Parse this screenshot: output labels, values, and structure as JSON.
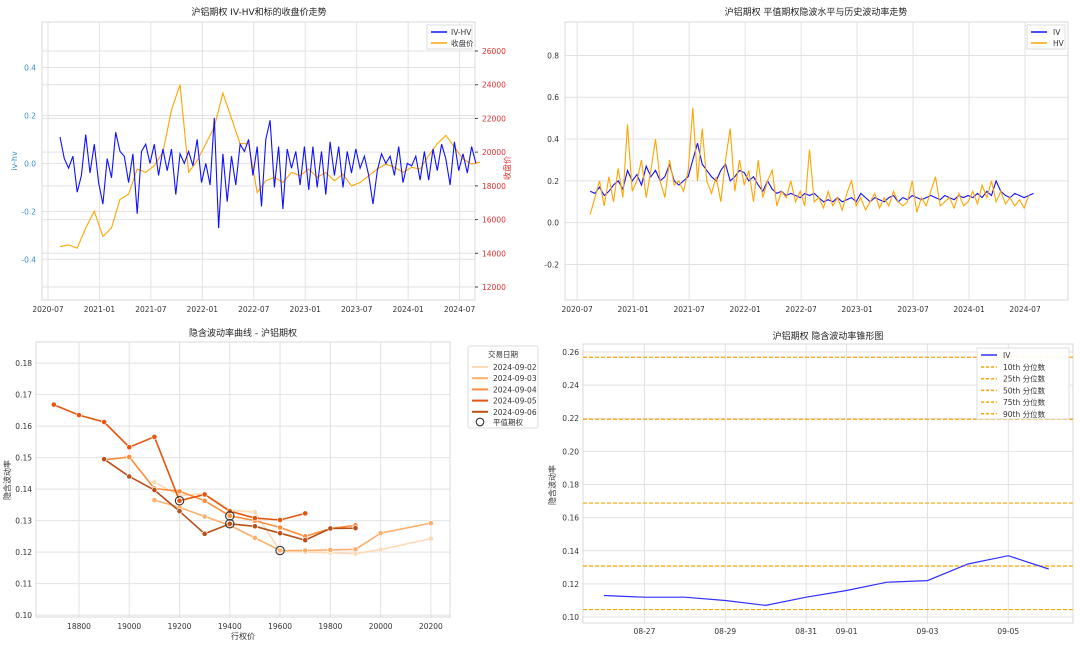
{
  "chart_data": [
    {
      "type": "line",
      "title": "沪铝期权 IV-HV和标的收盘价走势",
      "ylabel": "iv-hv",
      "ylabel_right": "收盘价",
      "ylim": [
        -0.57,
        0.59
      ],
      "ylim_right": [
        11230,
        27720
      ],
      "yticks": [
        -0.4,
        -0.2,
        0.0,
        0.2,
        0.4
      ],
      "yticks_right": [
        12000,
        14000,
        16000,
        18000,
        20000,
        22000,
        24000,
        26000
      ],
      "xticks": [
        "2020-07",
        "2021-01",
        "2021-07",
        "2022-01",
        "2022-07",
        "2023-01",
        "2023-07",
        "2024-01",
        "2024-07"
      ],
      "x_start": "2020-08",
      "legend": [
        "IV-HV",
        "收盘价"
      ],
      "legend_position": "top-right",
      "colors": {
        "ivhv": "#1010ff",
        "close": "#ffa500",
        "left_axis": "#3a8fc8",
        "right_axis": "#e03030"
      },
      "series": [
        {
          "name": "IV-HV",
          "step_months": 0.5,
          "values": [
            0.11,
            0.02,
            -0.02,
            0.03,
            -0.12,
            -0.05,
            0.12,
            -0.04,
            0.08,
            -0.08,
            -0.17,
            0.02,
            -0.06,
            0.13,
            0.05,
            0.03,
            -0.08,
            0.04,
            -0.21,
            0.05,
            0.08,
            0.0,
            0.08,
            -0.05,
            0.06,
            -0.03,
            0.06,
            -0.13,
            0.04,
            0.0,
            0.05,
            -0.01,
            0.1,
            -0.08,
            0.0,
            -0.09,
            0.19,
            -0.27,
            0.04,
            -0.16,
            0.03,
            -0.09,
            0.08,
            0.05,
            0.1,
            -0.05,
            0.07,
            -0.18,
            0.1,
            0.18,
            -0.1,
            0.07,
            -0.19,
            0.06,
            -0.02,
            0.05,
            -0.09,
            0.07,
            -0.11,
            0.07,
            -0.1,
            0.05,
            -0.13,
            0.09,
            -0.05,
            0.07,
            -0.1,
            0.05,
            -0.04,
            0.06,
            -0.02,
            0.03,
            -0.05,
            -0.17,
            -0.03,
            0.04,
            0.0,
            0.03,
            -0.05,
            0.07,
            -0.08,
            0.0,
            -0.01,
            0.03,
            -0.07,
            0.05,
            -0.07,
            0.06,
            -0.03,
            0.08,
            0.02,
            -0.09,
            0.09,
            -0.03,
            0.04,
            -0.04,
            0.07,
            0.0
          ]
        },
        {
          "name": "收盘价",
          "step_months": 1,
          "values": [
            14400,
            14500,
            14300,
            15500,
            16500,
            15000,
            15500,
            17200,
            17500,
            19000,
            18800,
            19200,
            20000,
            22500,
            24000,
            18800,
            19500,
            20500,
            21500,
            23500,
            22000,
            20500,
            20500,
            17600,
            18300,
            18500,
            18200,
            18800,
            18600,
            19000,
            18500,
            18800,
            18300,
            18700,
            18000,
            18200,
            18600,
            19000,
            19300,
            19100,
            18800,
            19100,
            19000,
            19800,
            20500,
            21000,
            20300,
            19600,
            19300,
            19400
          ]
        }
      ]
    },
    {
      "type": "line",
      "title": "沪铝期权 平值期权隐波水平与历史波动率走势",
      "ylim": [
        -0.37,
        0.96
      ],
      "yticks": [
        -0.2,
        0.0,
        0.2,
        0.4,
        0.6,
        0.8
      ],
      "xticks": [
        "2020-07",
        "2021-01",
        "2021-07",
        "2022-01",
        "2022-07",
        "2023-01",
        "2023-07",
        "2024-01",
        "2024-07"
      ],
      "x_start": "2020-08",
      "legend": [
        "IV",
        "HV"
      ],
      "legend_position": "top-right",
      "colors": {
        "iv": "#1010ff",
        "hv": "#ffa500"
      },
      "series": [
        {
          "name": "IV",
          "step_months": 0.5,
          "values": [
            0.15,
            0.14,
            0.17,
            0.13,
            0.15,
            0.18,
            0.2,
            0.16,
            0.25,
            0.2,
            0.23,
            0.18,
            0.27,
            0.22,
            0.25,
            0.2,
            0.22,
            0.28,
            0.2,
            0.18,
            0.2,
            0.22,
            0.3,
            0.38,
            0.28,
            0.25,
            0.22,
            0.2,
            0.25,
            0.28,
            0.2,
            0.22,
            0.25,
            0.24,
            0.2,
            0.22,
            0.18,
            0.15,
            0.2,
            0.16,
            0.14,
            0.15,
            0.13,
            0.14,
            0.13,
            0.12,
            0.14,
            0.13,
            0.14,
            0.12,
            0.1,
            0.11,
            0.1,
            0.12,
            0.1,
            0.11,
            0.12,
            0.1,
            0.14,
            0.12,
            0.1,
            0.12,
            0.11,
            0.1,
            0.12,
            0.13,
            0.1,
            0.12,
            0.11,
            0.13,
            0.12,
            0.11,
            0.12,
            0.13,
            0.12,
            0.11,
            0.13,
            0.12,
            0.11,
            0.13,
            0.12,
            0.13,
            0.12,
            0.14,
            0.12,
            0.15,
            0.13,
            0.2,
            0.15,
            0.13,
            0.12,
            0.14,
            0.13,
            0.12,
            0.13,
            0.14
          ]
        },
        {
          "name": "HV",
          "step_months": 0.5,
          "values": [
            0.04,
            0.12,
            0.2,
            0.08,
            0.22,
            0.1,
            0.26,
            0.12,
            0.47,
            0.15,
            0.2,
            0.3,
            0.12,
            0.25,
            0.4,
            0.2,
            0.12,
            0.3,
            0.18,
            0.2,
            0.15,
            0.25,
            0.55,
            0.2,
            0.45,
            0.2,
            0.14,
            0.22,
            0.1,
            0.3,
            0.45,
            0.15,
            0.3,
            0.18,
            0.25,
            0.1,
            0.3,
            0.12,
            0.2,
            0.25,
            0.08,
            0.15,
            0.12,
            0.2,
            0.1,
            0.15,
            0.08,
            0.35,
            0.1,
            0.12,
            0.07,
            0.15,
            0.08,
            0.12,
            0.06,
            0.14,
            0.2,
            0.08,
            0.12,
            0.06,
            0.1,
            0.14,
            0.07,
            0.12,
            0.08,
            0.15,
            0.1,
            0.08,
            0.1,
            0.2,
            0.05,
            0.12,
            0.08,
            0.15,
            0.22,
            0.08,
            0.1,
            0.12,
            0.07,
            0.14,
            0.08,
            0.1,
            0.15,
            0.09,
            0.18,
            0.12,
            0.2,
            0.1,
            0.15,
            0.09,
            0.12,
            0.08,
            0.11,
            0.07,
            0.13
          ]
        }
      ]
    },
    {
      "type": "line",
      "title": "隐含波动率曲线 - 沪铝期权",
      "xlabel": "行权价",
      "ylabel": "隐含波动率",
      "xlim": [
        18629,
        20276
      ],
      "ylim": [
        0.0994,
        0.1867
      ],
      "xticks": [
        18800,
        19000,
        19200,
        19400,
        19600,
        19800,
        20000,
        20200
      ],
      "yticks": [
        0.1,
        0.11,
        0.12,
        0.13,
        0.14,
        0.15,
        0.16,
        0.17,
        0.18
      ],
      "legend_title": "交易日期",
      "legend_position": "outside-right",
      "atm_label": "平值期权",
      "series": [
        {
          "name": "2024-09-02",
          "color": "#fdd9b5",
          "x": [
            19100,
            19200,
            19300,
            19400,
            19500,
            19600,
            19700,
            19800,
            19900,
            20000,
            20200
          ],
          "values": [
            0.1422,
            0.138,
            0.1385,
            0.1333,
            0.1327,
            0.1203,
            0.12,
            0.1198,
            0.1195,
            0.1208,
            0.1243
          ]
        },
        {
          "name": "2024-09-03",
          "color": "#fdae6b",
          "x": [
            19100,
            19200,
            19300,
            19400,
            19500,
            19600,
            19700,
            19800,
            19900,
            20000,
            20200
          ],
          "values": [
            0.1365,
            0.1342,
            0.1313,
            0.1285,
            0.1245,
            0.1205,
            0.1205,
            0.1207,
            0.1209,
            0.126,
            0.1292
          ]
        },
        {
          "name": "2024-09-04",
          "color": "#fd8d3c",
          "x": [
            18900,
            19000,
            19100,
            19200,
            19300,
            19400,
            19500,
            19600,
            19700,
            19800,
            19900
          ],
          "values": [
            0.1493,
            0.1502,
            0.1402,
            0.1393,
            0.1363,
            0.1315,
            0.13,
            0.1278,
            0.125,
            0.1275,
            0.1285
          ]
        },
        {
          "name": "2024-09-05",
          "color": "#e6550d",
          "x": [
            18700,
            18800,
            18900,
            19000,
            19100,
            19200,
            19300,
            19400,
            19500,
            19600,
            19700
          ],
          "values": [
            0.1668,
            0.1635,
            0.1613,
            0.1533,
            0.1566,
            0.1363,
            0.1383,
            0.133,
            0.1308,
            0.1302,
            0.1323
          ]
        },
        {
          "name": "2024-09-06",
          "color": "#b8501a",
          "x": [
            18900,
            19000,
            19100,
            19200,
            19300,
            19400,
            19500,
            19600,
            19700,
            19800,
            19900
          ],
          "values": [
            0.1495,
            0.144,
            0.1397,
            0.133,
            0.1258,
            0.129,
            0.1282,
            0.126,
            0.1238,
            0.1275,
            0.1276
          ]
        }
      ],
      "atm_points": [
        {
          "x": 19200,
          "y": 0.1363
        },
        {
          "x": 19400,
          "y": 0.1315
        },
        {
          "x": 19400,
          "y": 0.129
        },
        {
          "x": 19600,
          "y": 0.1205
        }
      ]
    },
    {
      "type": "line",
      "title": "沪铝期权 隐含波动率锥形图",
      "ylabel": "隐含波动率",
      "ylim": [
        0.0964,
        0.2648
      ],
      "yticks": [
        0.1,
        0.12,
        0.14,
        0.16,
        0.18,
        0.2,
        0.22,
        0.24,
        0.26
      ],
      "xticks": [
        {
          "label": "08-27",
          "day": 1
        },
        {
          "label": "08-29",
          "day": 3
        },
        {
          "label": "08-31",
          "day": 5
        },
        {
          "label": "09-01",
          "day": 6
        },
        {
          "label": "09-03",
          "day": 8
        },
        {
          "label": "09-05",
          "day": 10
        }
      ],
      "xlim_days": [
        -0.52,
        11.6
      ],
      "legend_position": "top-right",
      "colors": {
        "iv": "#3030ff",
        "quantile": "#ffa500"
      },
      "series": [
        {
          "name": "IV",
          "dates": [
            "08-26",
            "08-27",
            "08-28",
            "08-29",
            "08-30",
            "08-31",
            "09-01",
            "09-02",
            "09-03",
            "09-04",
            "09-05",
            "09-06"
          ],
          "values": [
            0.113,
            0.112,
            0.112,
            0.11,
            0.107,
            0.112,
            0.116,
            0.121,
            0.122,
            0.132,
            0.137,
            0.129
          ]
        }
      ],
      "quantiles": [
        {
          "name": "10th 分位数",
          "value": 0.1045
        },
        {
          "name": "25th 分位数",
          "value": 0.1308
        },
        {
          "name": "50th 分位数",
          "value": 0.1688
        },
        {
          "name": "75th 分位数",
          "value": 0.2194
        },
        {
          "name": "90th 分位数",
          "value": 0.2568
        }
      ]
    }
  ]
}
